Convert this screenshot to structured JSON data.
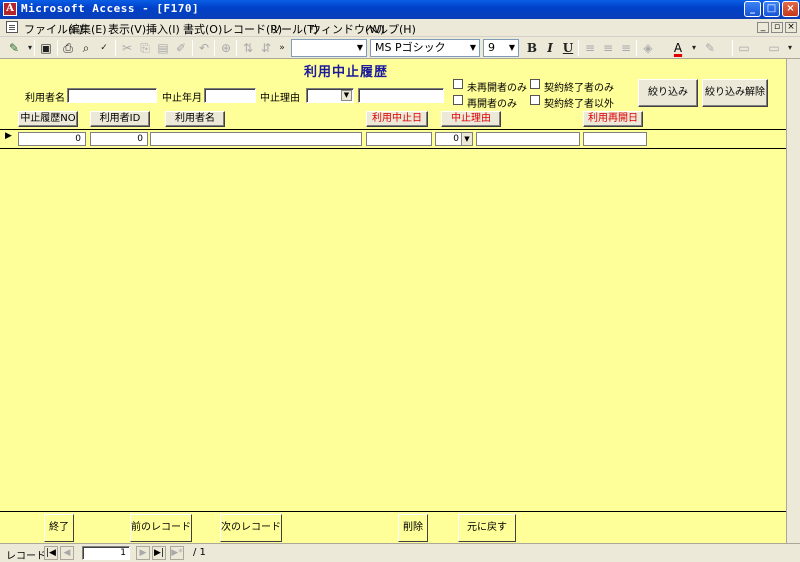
{
  "window": {
    "title": "Microsoft Access - [F170]",
    "app_icon": "access-icon",
    "controls": {
      "minimize": "_",
      "maximize": "□",
      "close": "×"
    }
  },
  "menubar": {
    "items": [
      "ファイル(F)",
      "編集(E)",
      "表示(V)",
      "挿入(I)",
      "書式(O)",
      "レコード(R)",
      "ツール(T)",
      "ウィンドウ(W)",
      "ヘルプ(H)"
    ],
    "mdi_controls": {
      "minimize": "_",
      "restore": "▫",
      "close": "×"
    }
  },
  "toolbar": {
    "font_name": "MS Pゴシック",
    "font_size": "9",
    "bold": "B",
    "italic": "I",
    "underline": "U"
  },
  "form": {
    "title": "利用中止履歴",
    "filters": {
      "user_name_label": "利用者名",
      "suspend_month_label": "中止年月",
      "suspend_reason_label": "中止理由",
      "not_resumed_only": "未再開者のみ",
      "resumed_only": "再開者のみ",
      "contract_ended_only": "契約終了者のみ",
      "excluding_contract_ended": "契約終了者以外",
      "apply_filter_button": "絞り込み",
      "clear_filter_button": "絞り込み解除"
    },
    "columns": {
      "history_no": "中止履歴NO",
      "user_id": "利用者ID",
      "user_name": "利用者名",
      "suspend_date": "利用中止日",
      "suspend_reason": "中止理由",
      "resume_date": "利用再開日"
    },
    "record": {
      "history_no": "0",
      "user_id": "0",
      "user_name": "",
      "suspend_date": "",
      "suspend_reason": "0",
      "reason_text": "",
      "resume_date": ""
    },
    "footer_buttons": {
      "close": "終了",
      "prev_record": "前のレコード",
      "next_record": "次のレコード",
      "delete": "削除",
      "undo": "元に戻す"
    }
  },
  "navigation": {
    "label": "レコード:",
    "current": "1",
    "total": "/ 1"
  },
  "colors": {
    "form_background": "#ffff99",
    "title_color": "#1a1a9a",
    "required_header_color": "#e00000"
  }
}
